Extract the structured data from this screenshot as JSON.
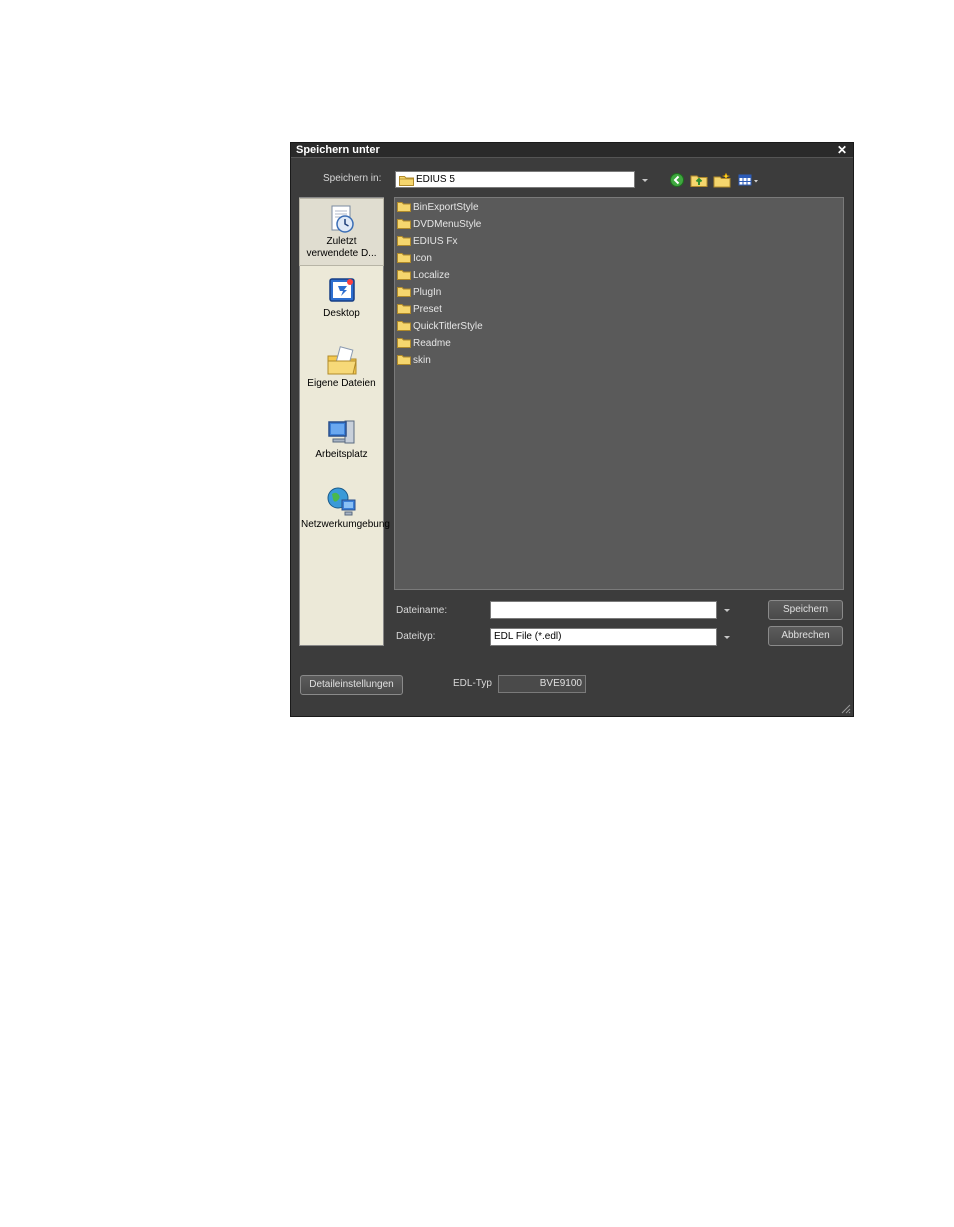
{
  "dialog": {
    "title": "Speichern unter",
    "close_label": "✕"
  },
  "save_in": {
    "label": "Speichern in:",
    "value": "EDIUS 5"
  },
  "places": [
    {
      "label": "Zuletzt verwendete D...",
      "icon": "recent-documents-icon"
    },
    {
      "label": "Desktop",
      "icon": "desktop-icon"
    },
    {
      "label": "Eigene Dateien",
      "icon": "my-documents-icon"
    },
    {
      "label": "Arbeitsplatz",
      "icon": "my-computer-icon"
    },
    {
      "label": "Netzwerkumgebung",
      "icon": "network-places-icon"
    }
  ],
  "files": [
    "BinExportStyle",
    "DVDMenuStyle",
    "EDIUS Fx",
    "Icon",
    "Localize",
    "PlugIn",
    "Preset",
    "QuickTitlerStyle",
    "Readme",
    "skin"
  ],
  "filename": {
    "label": "Dateiname:",
    "value": ""
  },
  "filetype": {
    "label": "Dateityp:",
    "value": "EDL File (*.edl)"
  },
  "buttons": {
    "save": "Speichern",
    "cancel": "Abbrechen",
    "details": "Detaileinstellungen"
  },
  "edl": {
    "label": "EDL-Typ",
    "value": "BVE9100"
  },
  "colors": {
    "dialog_bg": "#3c3c3c",
    "list_bg": "#5a5a5a",
    "places_bg": "#ece9d8"
  }
}
